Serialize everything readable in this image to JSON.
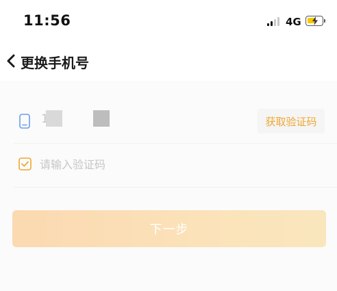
{
  "status_bar": {
    "time": "11:56",
    "network": "4G",
    "battery_color": "#f5c800"
  },
  "nav": {
    "title": "更换手机号",
    "back_icon": "chevron-left-icon"
  },
  "form": {
    "phone_value": "1",
    "phone_icon": "phone-icon",
    "get_code_label": "获取验证码",
    "code_placeholder": "请输入验证码",
    "code_icon": "checkbox-icon",
    "next_label": "下一步"
  },
  "colors": {
    "accent": "#f0a631",
    "phone_icon": "#6b9ee8",
    "button_gradient_start": "#fbd9b1",
    "button_gradient_end": "#fae6bd"
  }
}
